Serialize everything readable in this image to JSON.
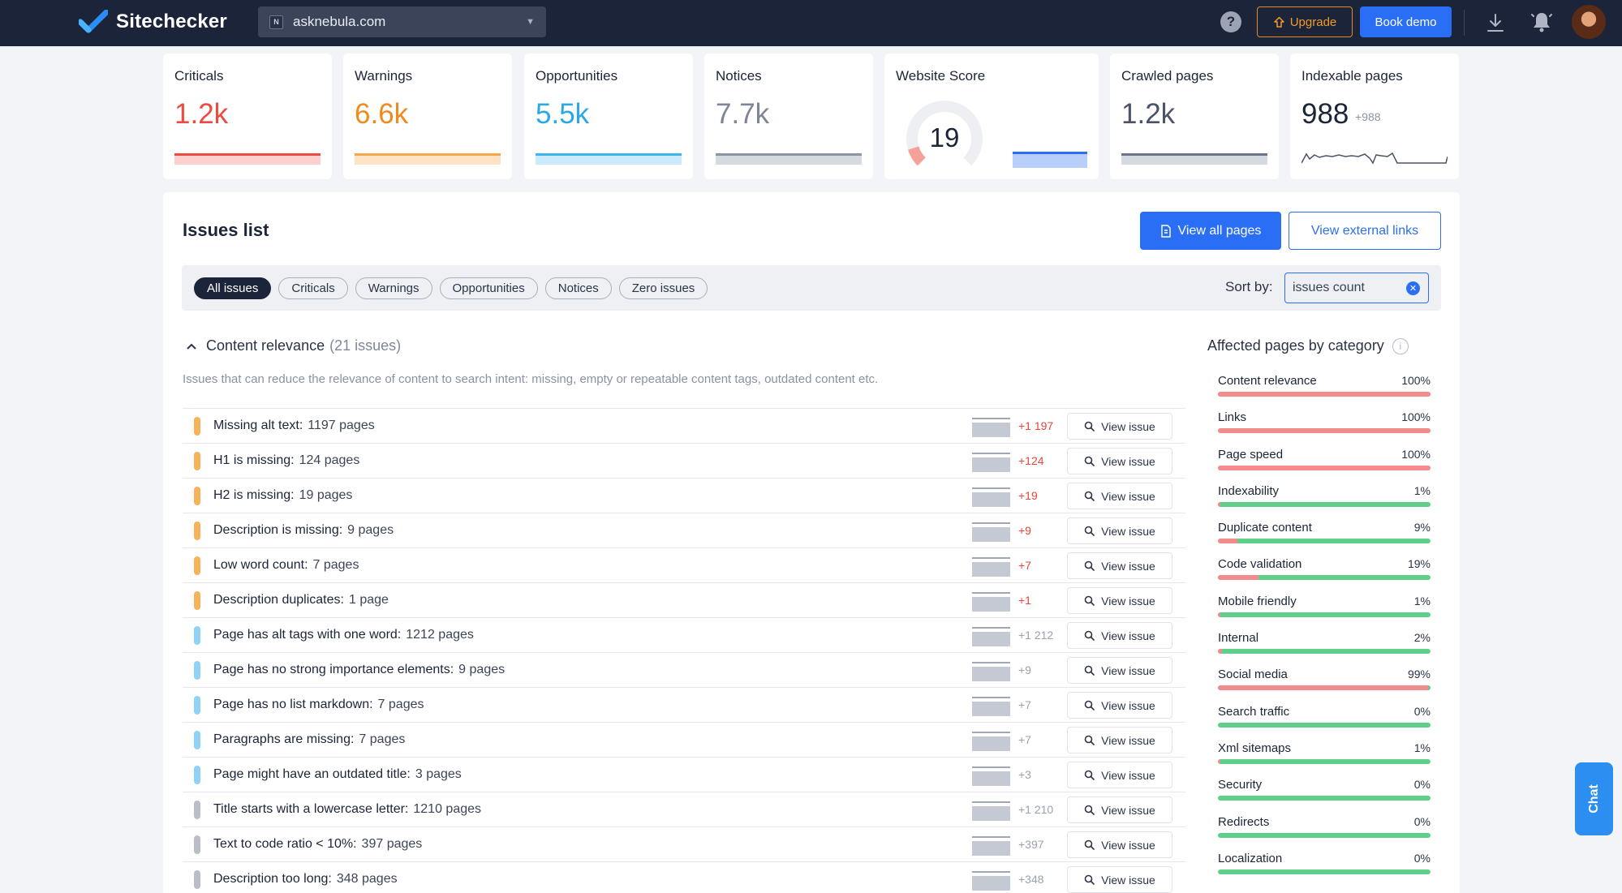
{
  "brand": {
    "name": "Sitechecker"
  },
  "header": {
    "site": "asknebula.com",
    "site_favicon": "N",
    "help": "?",
    "upgrade_label": "Upgrade",
    "demo_label": "Book demo",
    "icons": [
      "check-logo-icon",
      "chevron-down-icon",
      "help-icon",
      "upgrade-icon",
      "download-icon",
      "bell-icon"
    ]
  },
  "stats": [
    {
      "title": "Criticals",
      "value": "1.2k",
      "color": "#ee4a3f"
    },
    {
      "title": "Warnings",
      "value": "6.6k",
      "color": "#f08a1a"
    },
    {
      "title": "Opportunities",
      "value": "5.5k",
      "color": "#29a8e8"
    },
    {
      "title": "Notices",
      "value": "7.7k",
      "color": "#7d8596"
    },
    {
      "title": "Website Score",
      "value": "19",
      "score_fraction": 0.19
    },
    {
      "title": "Crawled pages",
      "value": "1.2k"
    },
    {
      "title": "Indexable pages",
      "value": "988",
      "delta": "+988"
    }
  ],
  "issues_panel": {
    "title": "Issues list",
    "view_all_label": "View all pages",
    "view_external_label": "View external links",
    "filters": [
      "All issues",
      "Criticals",
      "Warnings",
      "Opportunities",
      "Notices",
      "Zero issues"
    ],
    "active_filter": "All issues",
    "sort_label": "Sort by:",
    "sort_value": "issues count",
    "section": {
      "title": "Content relevance",
      "count": "(21 issues)",
      "description": "Issues that can reduce the relevance of content to search intent: missing, empty or repeatable content tags, outdated content etc."
    },
    "view_issue_label": "View issue",
    "rows": [
      {
        "label": "Missing alt text:",
        "pages": "1197 pages",
        "delta": "+1 197",
        "severity": "warning"
      },
      {
        "label": "H1 is missing:",
        "pages": "124 pages",
        "delta": "+124",
        "severity": "warning"
      },
      {
        "label": "H2 is missing:",
        "pages": "19 pages",
        "delta": "+19",
        "severity": "warning"
      },
      {
        "label": "Description is missing:",
        "pages": "9 pages",
        "delta": "+9",
        "severity": "warning"
      },
      {
        "label": "Low word count:",
        "pages": "7 pages",
        "delta": "+7",
        "severity": "warning"
      },
      {
        "label": "Description duplicates:",
        "pages": "1 page",
        "delta": "+1",
        "severity": "warning"
      },
      {
        "label": "Page has alt tags with one word:",
        "pages": "1212 pages",
        "delta": "+1 212",
        "severity": "opportunity"
      },
      {
        "label": "Page has no strong importance elements:",
        "pages": "9 pages",
        "delta": "+9",
        "severity": "opportunity"
      },
      {
        "label": "Page has no list markdown:",
        "pages": "7 pages",
        "delta": "+7",
        "severity": "opportunity"
      },
      {
        "label": "Paragraphs are missing:",
        "pages": "7 pages",
        "delta": "+7",
        "severity": "opportunity"
      },
      {
        "label": "Page might have an outdated title:",
        "pages": "3 pages",
        "delta": "+3",
        "severity": "opportunity"
      },
      {
        "label": "Title starts with a lowercase letter:",
        "pages": "1210 pages",
        "delta": "+1 210",
        "severity": "notice"
      },
      {
        "label": "Text to code ratio < 10%:",
        "pages": "397 pages",
        "delta": "+397",
        "severity": "notice"
      },
      {
        "label": "Description too long:",
        "pages": "348 pages",
        "delta": "+348",
        "severity": "notice"
      }
    ]
  },
  "categories": {
    "title": "Affected pages by category",
    "items": [
      {
        "name": "Content relevance",
        "pct": "100%",
        "value": 100
      },
      {
        "name": "Links",
        "pct": "100%",
        "value": 100
      },
      {
        "name": "Page speed",
        "pct": "100%",
        "value": 100
      },
      {
        "name": "Indexability",
        "pct": "1%",
        "value": 1
      },
      {
        "name": "Duplicate content",
        "pct": "9%",
        "value": 9
      },
      {
        "name": "Code validation",
        "pct": "19%",
        "value": 19
      },
      {
        "name": "Mobile friendly",
        "pct": "1%",
        "value": 1
      },
      {
        "name": "Internal",
        "pct": "2%",
        "value": 2
      },
      {
        "name": "Social media",
        "pct": "99%",
        "value": 99
      },
      {
        "name": "Search traffic",
        "pct": "0%",
        "value": 0
      },
      {
        "name": "Xml sitemaps",
        "pct": "1%",
        "value": 1
      },
      {
        "name": "Security",
        "pct": "0%",
        "value": 0
      },
      {
        "name": "Redirects",
        "pct": "0%",
        "value": 0
      },
      {
        "name": "Localization",
        "pct": "0%",
        "value": 0
      }
    ]
  },
  "chat": {
    "label": "Chat"
  },
  "colors": {
    "warning": "#f6b35a",
    "opportunity": "#8fd2f5",
    "notice": "#b9bec9",
    "delta_red": "#e8453c",
    "delta_gray": "#9aa1af",
    "accent": "#2b6ef6"
  }
}
